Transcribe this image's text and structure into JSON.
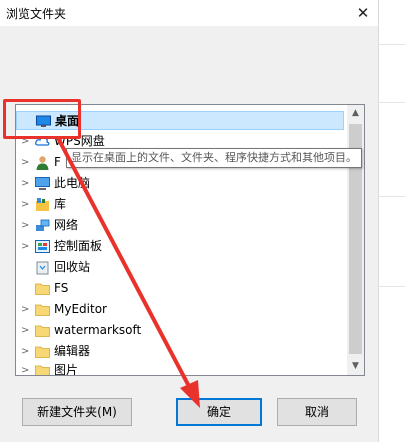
{
  "dialog": {
    "title": "浏览文件夹",
    "close_glyph": "✕"
  },
  "tree": {
    "items": [
      {
        "label": "桌面",
        "icon": "desktop-icon",
        "expandable": false,
        "selected": true
      },
      {
        "label": "WPS网盘",
        "icon": "cloud-icon",
        "expandable": true
      },
      {
        "label": "F",
        "icon": "user-icon",
        "expandable": true
      },
      {
        "label": "此电脑",
        "icon": "computer-icon",
        "expandable": true
      },
      {
        "label": "库",
        "icon": "library-icon",
        "expandable": true
      },
      {
        "label": "网络",
        "icon": "network-icon",
        "expandable": true
      },
      {
        "label": "控制面板",
        "icon": "control-panel-icon",
        "expandable": true
      },
      {
        "label": "回收站",
        "icon": "recycle-bin-icon",
        "expandable": false
      },
      {
        "label": "FS",
        "icon": "folder-icon",
        "expandable": false
      },
      {
        "label": "MyEditor",
        "icon": "folder-icon",
        "expandable": true
      },
      {
        "label": "watermarksoft",
        "icon": "folder-icon",
        "expandable": true
      },
      {
        "label": "编辑器",
        "icon": "folder-icon",
        "expandable": true
      },
      {
        "label": "图片",
        "icon": "folder-icon",
        "expandable": true
      }
    ],
    "tooltip": "显示在桌面上的文件、文件夹、程序快捷方式和其他项目。"
  },
  "buttons": {
    "new_folder": "新建文件夹(M)",
    "ok": "确定",
    "cancel": "取消"
  },
  "colors": {
    "annotation": "#e8322b",
    "selection": "#cce8ff",
    "default_button_border": "#0078d7"
  }
}
